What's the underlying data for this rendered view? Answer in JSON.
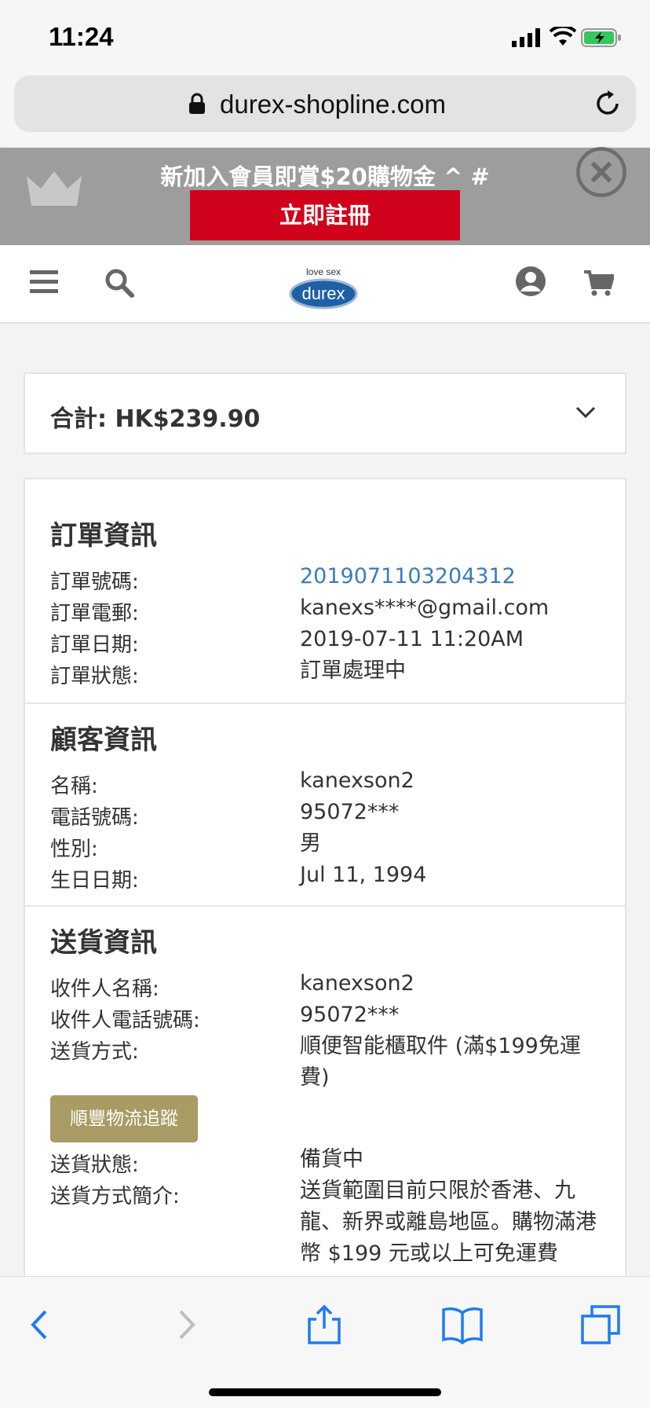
{
  "status_bar": {
    "time": "11:24"
  },
  "browser": {
    "url": "durex-shopline.com"
  },
  "promo": {
    "text": "新加入會員即賞$20購物金 ^ #",
    "button": "立即註冊"
  },
  "summary": {
    "total": "合計: HK$239.90"
  },
  "order_info": {
    "title": "訂單資訊",
    "rows": [
      {
        "label": "訂單號碼:",
        "value": "2019071103204312"
      },
      {
        "label": "訂單電郵:",
        "value": "kanexs****@gmail.com"
      },
      {
        "label": "訂單日期:",
        "value": "2019-07-11 11:20AM"
      },
      {
        "label": "訂單狀態:",
        "value": "訂單處理中"
      }
    ]
  },
  "customer_info": {
    "title": "顧客資訊",
    "rows": [
      {
        "label": "名稱:",
        "value": "kanexson2"
      },
      {
        "label": "電話號碼:",
        "value": "95072***"
      },
      {
        "label": "性別:",
        "value": "男"
      },
      {
        "label": "生日日期:",
        "value": "Jul 11, 1994"
      }
    ]
  },
  "delivery_info": {
    "title": "送貨資訊",
    "rows": [
      {
        "label": "收件人名稱:",
        "value": "kanexson2"
      },
      {
        "label": "收件人電話號碼:",
        "value": "95072***"
      },
      {
        "label": "送貨方式:",
        "value": "順便智能櫃取件 (滿$199免運費)"
      },
      {
        "label": "送貨狀態:",
        "value": "備貨中"
      },
      {
        "label": "送貨方式簡介:",
        "value": "送貨範圍目前只限於香港、九龍、新界或離島地區。購物滿港幣 $199 元或以上可免運費"
      }
    ],
    "tracking_button": "順豐物流追蹤"
  },
  "colors": {
    "accent_red": "#d0021b",
    "link_blue": "#3b7bbf",
    "track_gold": "#a89b64"
  }
}
